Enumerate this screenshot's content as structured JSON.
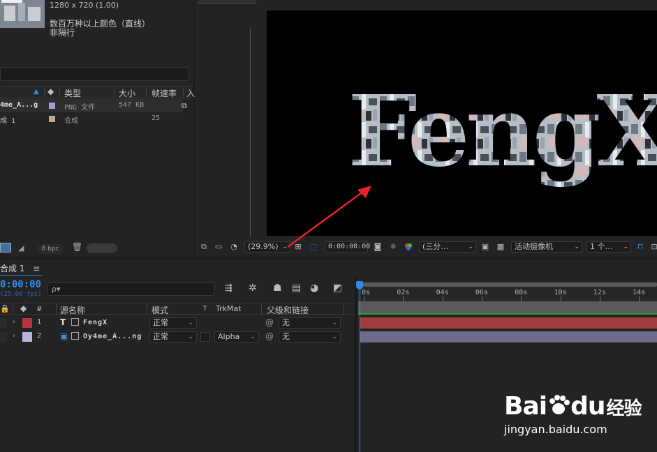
{
  "project": {
    "resolution": "1280 x 720 (1.00)",
    "color_desc": "数百万种以上颜色（直线）",
    "interlace": "非隔行",
    "columns": {
      "type": "类型",
      "size": "大小",
      "framerate": "帧速率",
      "extra": "入"
    },
    "rows": [
      {
        "name": "4me_A...g",
        "color": "#a59ed0",
        "type": "PNG 文件",
        "size": "547 KB",
        "fps": ""
      },
      {
        "name": "成 1",
        "color": "#c0a882",
        "type": "合成",
        "size": "",
        "fps": "25"
      }
    ],
    "bpc": "8 bpc"
  },
  "viewer": {
    "canvas_text": "FengX",
    "zoom": "(29.9%)",
    "timecode": "0:00:00:00",
    "resolution_select": "(三分…",
    "camera_select": "活动摄像机",
    "view_select": "1 个…"
  },
  "timeline": {
    "tab_label": "合成 1",
    "menu_glyph": "≡",
    "timecode": "0:00:00",
    "fps": "(25.00 fps)",
    "search_placeholder": "ρ▾",
    "columns": {
      "num": "#",
      "source_name": "源名称",
      "mode": "模式",
      "t": "T",
      "trkmat": "TrkMat",
      "parent": "父级和链接"
    },
    "layers": [
      {
        "num": "1",
        "type_glyph": "T",
        "name": "FengX",
        "color": "#b5353e",
        "mode": "正常",
        "trkmat": "",
        "parent": "无"
      },
      {
        "num": "2",
        "type_glyph": "▣",
        "name": "Oy4me_A...ng",
        "color": "#b7b3d8",
        "mode": "正常",
        "trkmat": "Alpha",
        "parent": "无"
      }
    ],
    "ruler_ticks": [
      "0s",
      "02s",
      "04s",
      "06s",
      "08s",
      "10s",
      "12s",
      "14s"
    ]
  },
  "watermark": {
    "brand_a": "Bai",
    "brand_b": "du",
    "brand_c": "经验",
    "url": "jingyan.baidu.com"
  },
  "colors": {
    "accent": "#2d8ceb",
    "layer1_bar": "#a23c3c",
    "layer2_bar": "#6d6a8a",
    "arrow": "#e8232a"
  }
}
